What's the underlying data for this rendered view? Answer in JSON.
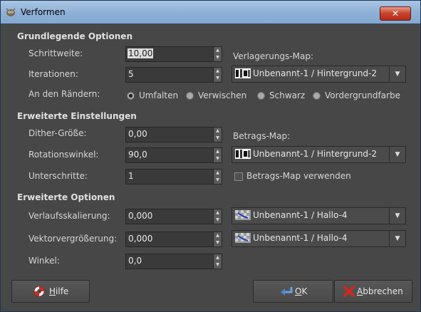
{
  "window": {
    "title": "Verformen",
    "close_label": "✕"
  },
  "sections": {
    "basic": "Grundlegende Optionen",
    "advanced_settings": "Erweiterte Einstellungen",
    "advanced_options": "Erweiterte Optionen"
  },
  "basic": {
    "step_label": "Schrittweite:",
    "step_value": "10,00",
    "iterations_label": "Iterationen:",
    "iterations_value": "5",
    "edges_label": "An den Rändern:",
    "displacement_map_label": "Verlagerungs-Map:",
    "displacement_map_value": "Unbenannt-1 / Hintergrund-2",
    "edge_options": [
      {
        "label": "Umfalten",
        "selected": true
      },
      {
        "label": "Verwischen",
        "selected": false
      },
      {
        "label": "Schwarz",
        "selected": false
      },
      {
        "label": "Vordergrundfarbe",
        "selected": false
      }
    ]
  },
  "advanced_settings": {
    "dither_label": "Dither-Größe:",
    "dither_value": "0,00",
    "rotation_label": "Rotationswinkel:",
    "rotation_value": "90,0",
    "substeps_label": "Unterschritte:",
    "substeps_value": "1",
    "magnitude_map_label": "Betrags-Map:",
    "magnitude_map_value": "Unbenannt-1 / Hintergrund-2",
    "use_magnitude_label": "Betrags-Map verwenden",
    "use_magnitude_checked": false
  },
  "advanced_options": {
    "gradient_scale_label": "Verlaufsskalierung:",
    "gradient_scale_value": "0,000",
    "gradient_map_value": "Unbenannt-1 / Hallo-4",
    "vector_mag_label": "Vektorvergrößerung:",
    "vector_mag_value": "0,000",
    "vector_map_value": "Unbenannt-1 / Hallo-4",
    "angle_label": "Winkel:",
    "angle_value": "0,0"
  },
  "buttons": {
    "help": {
      "prefix": "",
      "mnemonic": "H",
      "rest": "ilfe"
    },
    "ok": {
      "prefix": "",
      "mnemonic": "O",
      "rest": "K"
    },
    "cancel": {
      "prefix": "",
      "mnemonic": "A",
      "rest": "bbrechen"
    }
  },
  "colors": {
    "titlebar": "#8eb0d6",
    "background": "#474747",
    "close": "#c8412a"
  },
  "icons": {
    "app": "gimp-wilber-icon",
    "help": "lifebuoy-icon",
    "ok": "return-arrow-icon",
    "cancel": "red-x-icon",
    "layer_thumb": "layer-thumbnail-icon",
    "dropdown": "chevron-down-icon"
  }
}
